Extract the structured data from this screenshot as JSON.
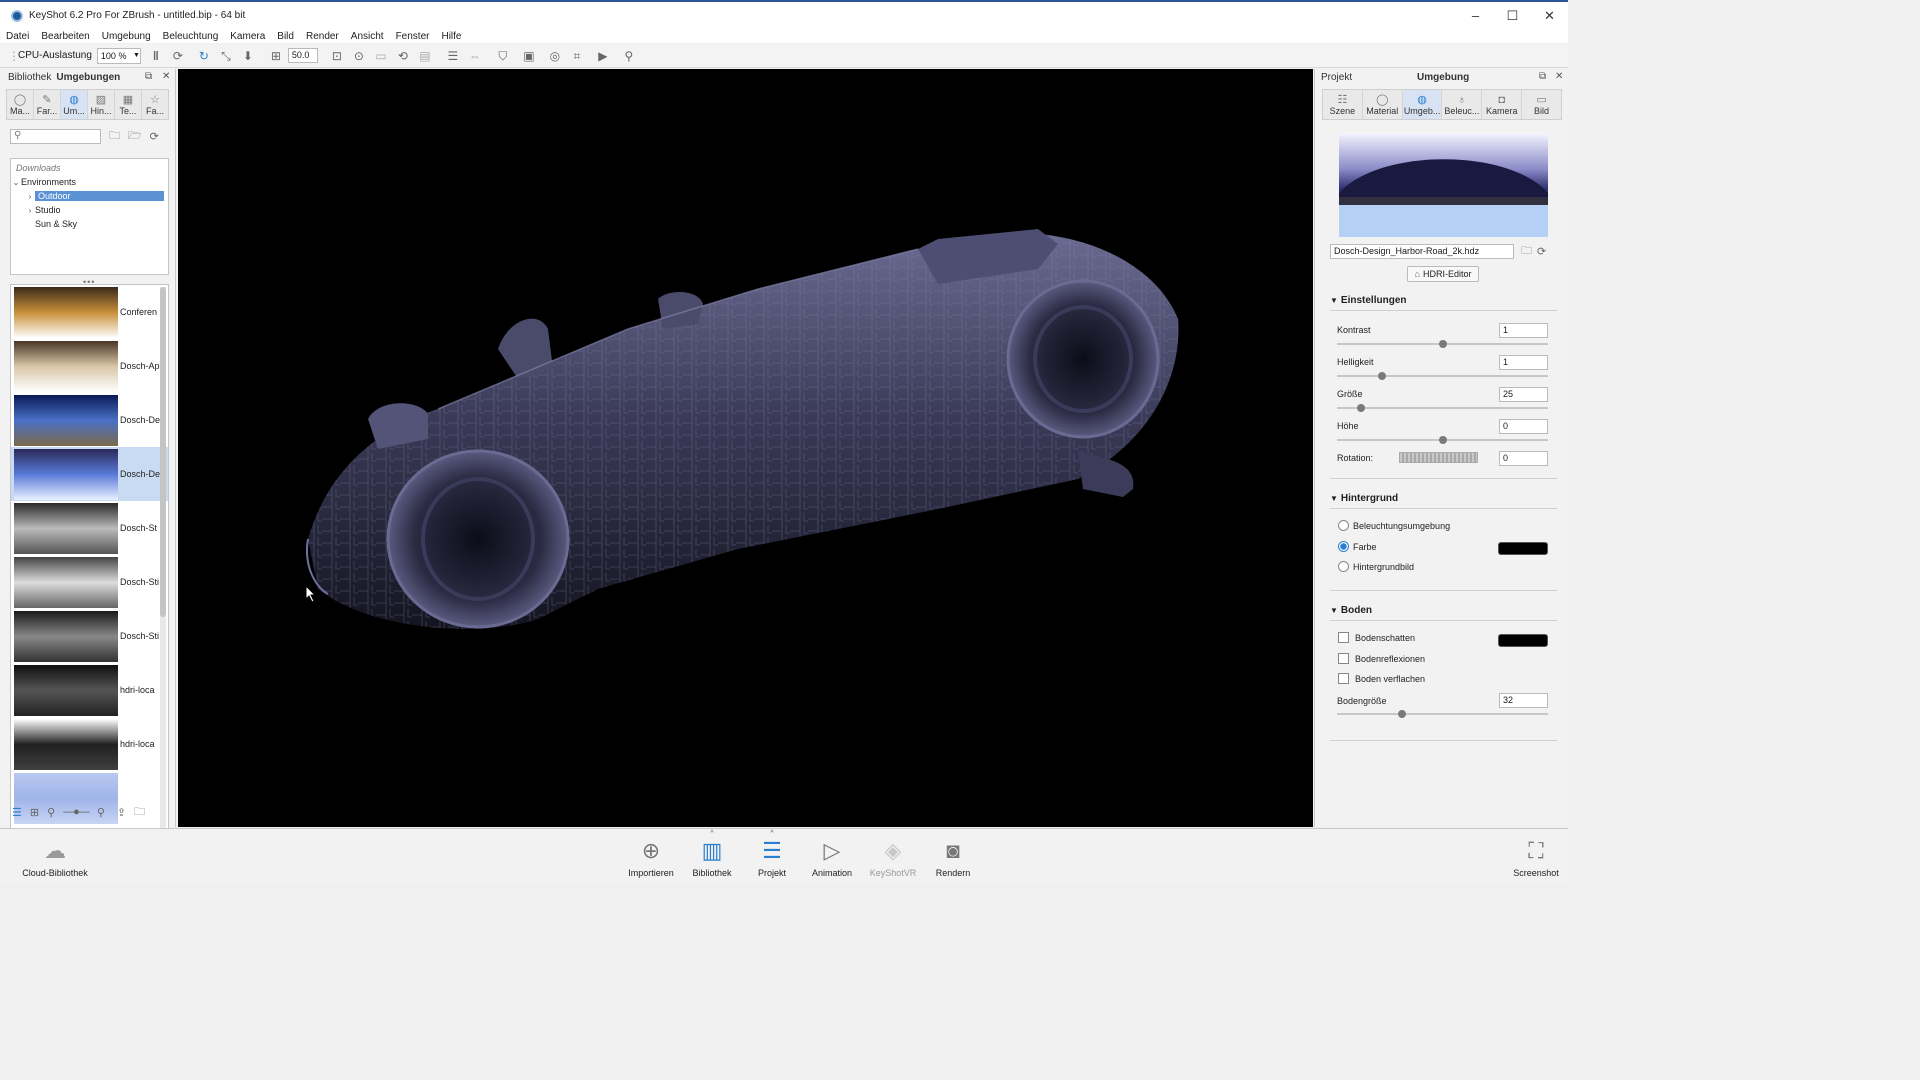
{
  "window": {
    "title": "KeyShot 6.2 Pro For ZBrush - untitled.bip  - 64 bit",
    "minimize": "–",
    "maximize": "☐",
    "close": "✕"
  },
  "menu": [
    "Datei",
    "Bearbeiten",
    "Umgebung",
    "Beleuchtung",
    "Kamera",
    "Bild",
    "Render",
    "Ansicht",
    "Fenster",
    "Hilfe"
  ],
  "toolbar": {
    "cpu_label": "CPU-Auslastung",
    "cpu_value": "100 %",
    "zoom_value": "50.0"
  },
  "library": {
    "panel_title": "Bibliothek",
    "panel_subtitle": "Umgebungen",
    "tabs": [
      {
        "label": "Ma...",
        "icon": "material-icon"
      },
      {
        "label": "Far...",
        "icon": "color-icon"
      },
      {
        "label": "Um...",
        "icon": "globe-icon"
      },
      {
        "label": "Hin...",
        "icon": "image-icon"
      },
      {
        "label": "Te...",
        "icon": "texture-icon"
      },
      {
        "label": "Fa...",
        "icon": "star-icon"
      }
    ],
    "search_placeholder": "",
    "tree": {
      "header": "Downloads",
      "root": "Environments",
      "items": [
        "Outdoor",
        "Studio",
        "Sun & Sky"
      ]
    },
    "thumbnails": [
      {
        "label": "Conferen",
        "colors": [
          "#3a2a1a",
          "#c8903a",
          "#ffffff"
        ]
      },
      {
        "label": "Dosch-Ap",
        "colors": [
          "#4a3525",
          "#d9c7a8",
          "#ffffff"
        ]
      },
      {
        "label": "Dosch-De",
        "colors": [
          "#0a1a55",
          "#4a70c8",
          "#7a6a4a"
        ]
      },
      {
        "label": "Dosch-De",
        "colors": [
          "#2a2a5a",
          "#5a7ad8",
          "#e8f0ff"
        ]
      },
      {
        "label": "Dosch-St",
        "colors": [
          "#2a2a2a",
          "#bbbbbb",
          "#555555"
        ]
      },
      {
        "label": "Dosch-Sti",
        "colors": [
          "#444444",
          "#dddddd",
          "#666666"
        ]
      },
      {
        "label": "Dosch-Sti",
        "colors": [
          "#1a1a1a",
          "#888888",
          "#333333"
        ]
      },
      {
        "label": "hdri-loca",
        "colors": [
          "#101010",
          "#555555",
          "#222222"
        ]
      },
      {
        "label": "hdri-loca",
        "colors": [
          "#ffffff",
          "#202020",
          "#404040"
        ]
      },
      {
        "label": "",
        "colors": [
          "#b8c8f0",
          "#a0b4e8",
          "#c8d4f4"
        ]
      }
    ],
    "cloud_label": "Cloud-Bibliothek"
  },
  "project": {
    "panel_title": "Projekt",
    "panel_subtitle": "Umgebung",
    "tabs": [
      {
        "label": "Szene",
        "icon": "scene-icon"
      },
      {
        "label": "Material",
        "icon": "material-icon"
      },
      {
        "label": "Umgeb...",
        "icon": "globe-icon"
      },
      {
        "label": "Beleuc...",
        "icon": "bulb-icon"
      },
      {
        "label": "Kamera",
        "icon": "camera-icon"
      },
      {
        "label": "Bild",
        "icon": "image-icon"
      }
    ],
    "hdri_file": "Dosch-Design_Harbor-Road_2k.hdz",
    "hdri_editor_label": "HDRI-Editor",
    "settings": {
      "title": "Einstellungen",
      "kontrast_label": "Kontrast",
      "kontrast_value": "1",
      "kontrast_slider": 0.5,
      "helligkeit_label": "Helligkeit",
      "helligkeit_value": "1",
      "helligkeit_slider": 0.2,
      "groesse_label": "Größe",
      "groesse_value": "25",
      "groesse_slider": 0.1,
      "hoehe_label": "Höhe",
      "hoehe_value": "0",
      "hoehe_slider": 0.5,
      "rotation_label": "Rotation:",
      "rotation_value": "0"
    },
    "background": {
      "title": "Hintergrund",
      "options": [
        "Beleuchtungsumgebung",
        "Farbe",
        "Hintergrundbild"
      ],
      "selected": "Farbe",
      "color": "#000000"
    },
    "ground": {
      "title": "Boden",
      "shadow_label": "Bodenschatten",
      "shadow_checked": false,
      "reflections_label": "Bodenreflexionen",
      "reflections_checked": false,
      "flatten_label": "Boden verflachen",
      "flatten_checked": false,
      "shadow_color": "#000000",
      "size_label": "Bodengröße",
      "size_value": "32",
      "size_slider": 0.3
    }
  },
  "bottom_bar": {
    "buttons": [
      {
        "label": "Importieren",
        "icon": "import-icon"
      },
      {
        "label": "Bibliothek",
        "icon": "book-icon"
      },
      {
        "label": "Projekt",
        "icon": "project-icon"
      },
      {
        "label": "Animation",
        "icon": "play-icon"
      },
      {
        "label": "KeyShotVR",
        "icon": "vr-icon"
      },
      {
        "label": "Rendern",
        "icon": "render-icon"
      }
    ],
    "screenshot_label": "Screenshot"
  },
  "colors": {
    "accent": "#2a7fd0",
    "selection": "#5b92d6",
    "viewport_bg": "#000000"
  }
}
